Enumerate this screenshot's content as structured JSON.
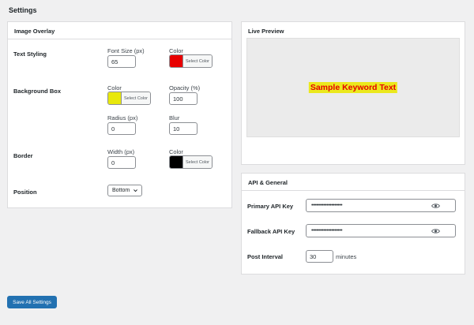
{
  "page": {
    "title": "Settings"
  },
  "overlay": {
    "title": "Image Overlay",
    "text_styling": {
      "label": "Text Styling",
      "font_size_label": "Font Size (px)",
      "font_size_value": "65",
      "color_label": "Color",
      "color_value": "#e80000",
      "color_button": "Select Color"
    },
    "background_box": {
      "label": "Background Box",
      "color_label": "Color",
      "color_value": "#e8e80c",
      "color_button": "Select Color",
      "opacity_label": "Opacity (%)",
      "opacity_value": "100",
      "radius_label": "Radius (px)",
      "radius_value": "0",
      "blur_label": "Blur",
      "blur_value": "10"
    },
    "border": {
      "label": "Border",
      "width_label": "Width (px)",
      "width_value": "0",
      "color_label": "Color",
      "color_value": "#000000",
      "color_button": "Select Color"
    },
    "position": {
      "label": "Position",
      "selected": "Bottom"
    }
  },
  "preview": {
    "title": "Live Preview",
    "sample_text": "Sample Keyword Text",
    "text_color": "#e50000",
    "box_color": "#ebe81d"
  },
  "api": {
    "title": "API & General",
    "primary_label": "Primary API Key",
    "primary_value": "••••••••••••••••••••",
    "fallback_label": "Fallback API Key",
    "fallback_value": "••••••••••••••••••••",
    "interval_label": "Post Interval",
    "interval_value": "30",
    "interval_unit": "minutes"
  },
  "actions": {
    "save_label": "Save All Settings"
  },
  "icons": {
    "eye": "eye-icon",
    "chevron": "chevron-down-icon"
  }
}
